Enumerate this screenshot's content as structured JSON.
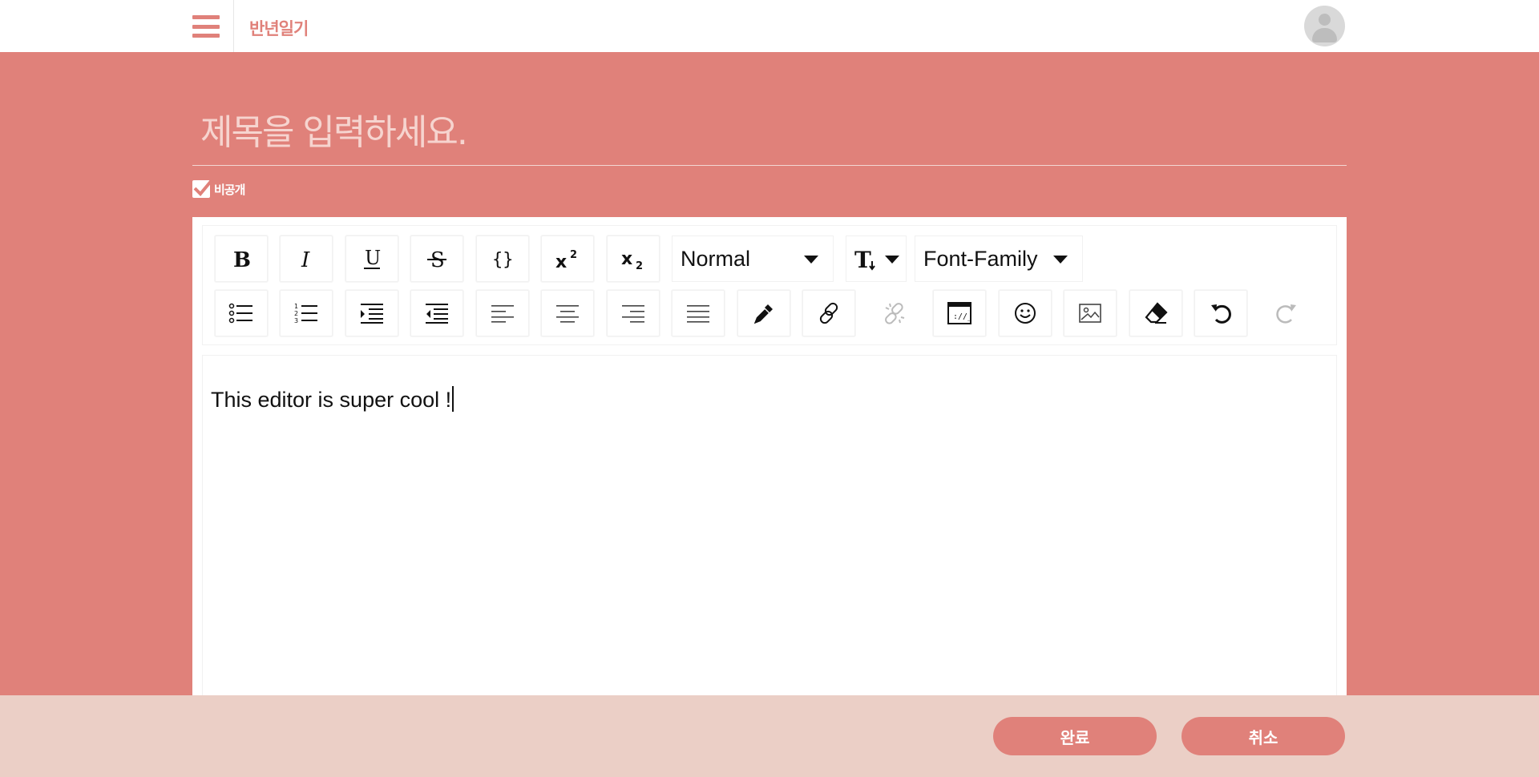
{
  "header": {
    "brand": "반년일기"
  },
  "title": {
    "placeholder": "제목을 입력하세요."
  },
  "private": {
    "label": "비공개",
    "checked": true
  },
  "toolbar": {
    "block_type": "Normal",
    "font_family": "Font-Family"
  },
  "editor": {
    "content": "This editor is super cool !"
  },
  "footer": {
    "done_label": "완료",
    "cancel_label": "취소"
  },
  "colors": {
    "accent": "#e0817a",
    "footer_bg": "#ebcfc6"
  }
}
